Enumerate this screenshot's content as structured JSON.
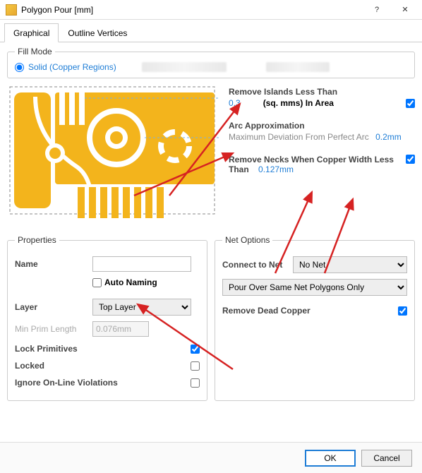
{
  "titlebar": {
    "title": "Polygon Pour [mm]"
  },
  "tabs": {
    "graphical": "Graphical",
    "outline": "Outline Vertices"
  },
  "fillmode": {
    "legend": "Fill Mode",
    "solid_label": "Solid (Copper Regions)"
  },
  "settings": {
    "remove_islands_title": "Remove Islands Less Than",
    "remove_islands_value": "0.3",
    "remove_islands_unit": "(sq. mms) In Area",
    "arc_title": "Arc Approximation",
    "arc_sub": "Maximum Deviation From Perfect Arc",
    "arc_value": "0.2mm",
    "remove_necks_title": "Remove Necks When Copper Width Less Than",
    "remove_necks_value": "0.127mm"
  },
  "properties": {
    "legend": "Properties",
    "name_label": "Name",
    "name_value": "",
    "auto_naming": "Auto Naming",
    "layer_label": "Layer",
    "layer_value": "Top Layer",
    "min_prim_label": "Min Prim Length",
    "min_prim_value": "0.076mm",
    "lock_primitives": "Lock Primitives",
    "locked": "Locked",
    "ignore_violations": "Ignore On-Line Violations"
  },
  "netoptions": {
    "legend": "Net Options",
    "connect_label": "Connect to Net",
    "connect_value": "No Net",
    "pour_mode": "Pour Over Same Net Polygons Only",
    "remove_dead": "Remove Dead Copper"
  },
  "footer": {
    "ok": "OK",
    "cancel": "Cancel"
  }
}
